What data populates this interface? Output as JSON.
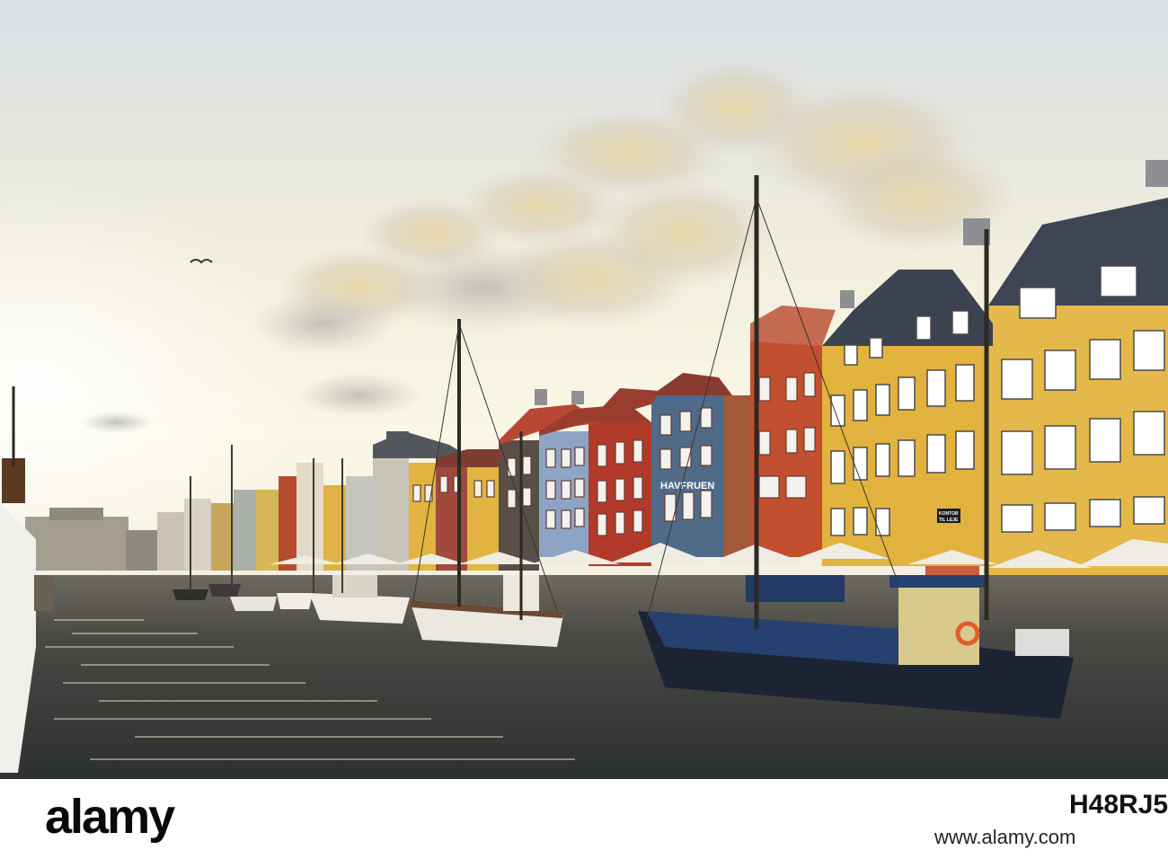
{
  "photo": {
    "sign_main": "HAVFRUEN",
    "sign_small_1": "KONTOR",
    "sign_small_2": "TIL LEJE"
  },
  "footer": {
    "brand": "alamy",
    "image_id": "H48RJ5",
    "site": "www.alamy.com"
  },
  "colors": {
    "sky_top": "#dde0e2",
    "sky_glow": "#f6f0dc",
    "water": "#3f4343",
    "yellow_facade": "#e2b23e",
    "red_facade": "#b34427",
    "blue_facade": "#4f6b88",
    "roof": "#3b4250"
  }
}
